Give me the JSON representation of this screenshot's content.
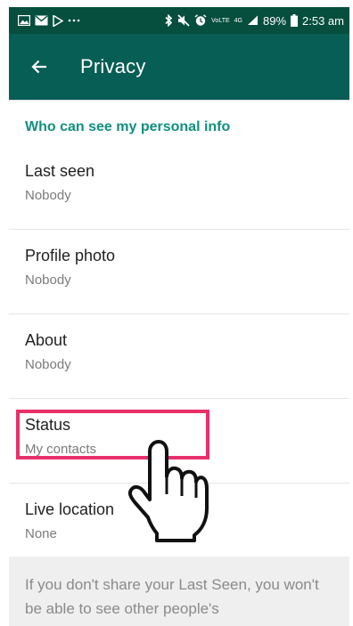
{
  "status_bar": {
    "battery": "89%",
    "time": "2:53 am",
    "network_label": "4G",
    "volte_label": "VoLTE"
  },
  "app_bar": {
    "title": "Privacy"
  },
  "section": {
    "header": "Who can see my personal info"
  },
  "items": [
    {
      "title": "Last seen",
      "value": "Nobody"
    },
    {
      "title": "Profile photo",
      "value": "Nobody"
    },
    {
      "title": "About",
      "value": "Nobody"
    },
    {
      "title": "Status",
      "value": "My contacts"
    },
    {
      "title": "Live location",
      "value": "None"
    }
  ],
  "footer": {
    "text": "If you don't share your Last Seen, you won't be able to see other people's"
  },
  "colors": {
    "status_bar": "#064e3e",
    "app_bar": "#075e54",
    "accent": "#10907e",
    "highlight": "#e8316a"
  }
}
